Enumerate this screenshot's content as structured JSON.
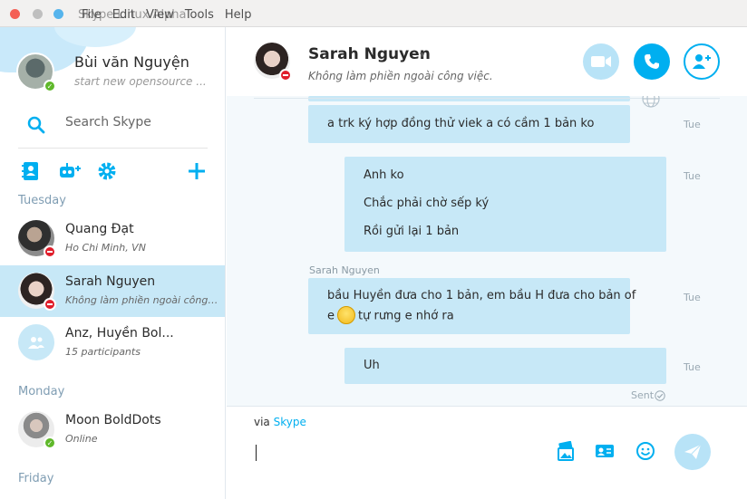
{
  "window": {
    "title": "Skype Linux Alpha",
    "menu": [
      "File",
      "Edit",
      "View",
      "Tools",
      "Help"
    ]
  },
  "me": {
    "name": "Bùi văn Nguyện",
    "mood": "start new opensource ..."
  },
  "search": {
    "placeholder": "Search Skype"
  },
  "sections": {
    "tuesday": "Tuesday",
    "monday": "Monday",
    "friday": "Friday"
  },
  "contacts": [
    {
      "name": "Quang Đạt",
      "sub": "Ho Chi Minh, VN",
      "status": "dnd"
    },
    {
      "name": "Sarah Nguyen",
      "sub": "Không làm phiền ngoài công ...",
      "status": "dnd",
      "active": true
    },
    {
      "name": "Anz, Huyền Bol...",
      "sub": "15 participants",
      "status": "group"
    },
    {
      "name": "Moon BoldDots",
      "sub": "Online",
      "status": "online"
    }
  ],
  "chat": {
    "name": "Sarah Nguyen",
    "mood": "Không làm phiền ngoài công việc."
  },
  "messages": [
    {
      "lines": [
        "a trk ký hợp đồng thử viek a có cầm 1 bản ko"
      ],
      "time": "Tue"
    },
    {
      "lines": [
        "Anh ko",
        "Chắc phải chờ sếp ký",
        "Rồi gửi lại 1 bản"
      ],
      "time": "Tue"
    },
    {
      "sender": "Sarah Nguyen",
      "line1": "bầu Huyền đưa cho 1 bản, em bầu H đưa cho bản of",
      "line2_a": "e",
      "line2_b": "tự rưng e nhớ ra",
      "time": "Tue"
    },
    {
      "lines": [
        "Uh"
      ],
      "time": "Tue"
    }
  ],
  "sent_label": "Sent",
  "composer": {
    "via": "via",
    "via_link": "Skype"
  },
  "colors": {
    "accent": "#00aff0",
    "bubble": "#c7e8f7",
    "dnd": "#e01e2b",
    "online": "#5fb82a"
  }
}
